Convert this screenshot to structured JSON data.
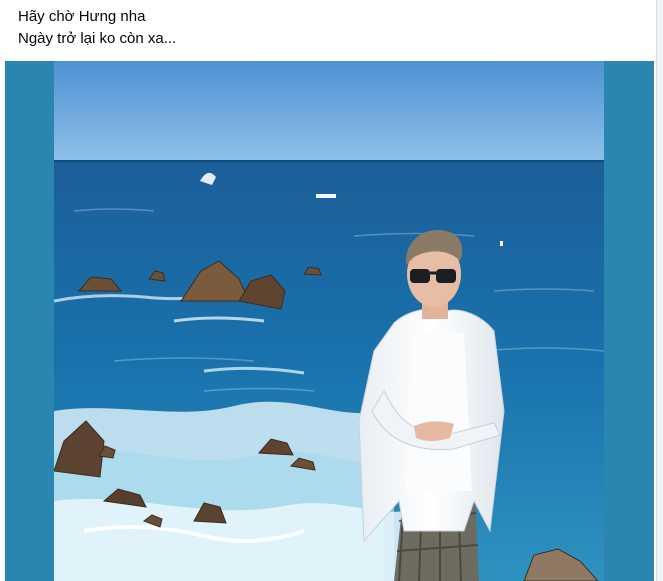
{
  "post": {
    "text_lines": [
      "Hãy chờ Hưng nha",
      "Ngày trở lại ko còn xa..."
    ]
  },
  "media": {
    "alt": "Man in white shirt and dark sunglasses standing on a cliff above a rocky blue sea",
    "colors": {
      "frame": "#2a86b0",
      "sky": "#5f9fd8",
      "sea": "#1a6aa4",
      "foam": "#e8f4fa",
      "rock": "#6b5038"
    }
  }
}
